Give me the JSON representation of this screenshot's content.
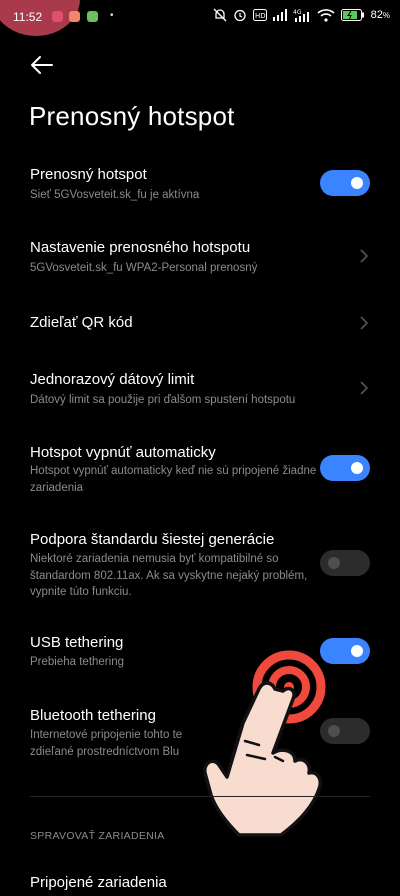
{
  "status_bar": {
    "time": "11:52",
    "battery_pct": "82",
    "extra_dot": "•",
    "network_label": "4G",
    "colors": {
      "recording": "#a93a4c",
      "notif1": "#e0506e",
      "notif2": "#f0876b",
      "notif3": "#6ac259"
    }
  },
  "header": {
    "back_icon": "arrow-left-icon",
    "title": "Prenosný hotspot"
  },
  "settings": {
    "portable_hotspot": {
      "title": "Prenosný hotspot",
      "subtitle": "Sieť 5GVosveteit.sk_fu je aktívna",
      "toggle_on": true
    },
    "hotspot_config": {
      "title": "Nastavenie prenosného hotspotu",
      "subtitle": "5GVosveteit.sk_fu WPA2-Personal prenosný"
    },
    "share_qr": {
      "title": "Zdieľať QR kód"
    },
    "data_limit": {
      "title": "Jednorazový dátový limit",
      "subtitle": "Dátový limit sa použije pri ďalšom spustení hotspotu"
    },
    "auto_off": {
      "title": "Hotspot vypnúť automaticky",
      "subtitle": "Hotspot vypnúť automaticky keď nie sú pripojené žiadne zariadenia",
      "toggle_on": true
    },
    "wifi6": {
      "title": "Podpora štandardu šiestej generácie",
      "subtitle": "Niektoré zariadenia nemusia byť kompatibilné so štandardom 802.11ax. Ak sa vyskytne nejaký problém, vypnite túto funkciu.",
      "toggle_on": false
    },
    "usb_tethering": {
      "title": "USB tethering",
      "subtitle": "Prebieha tethering",
      "toggle_on": true
    },
    "bt_tethering": {
      "title": "Bluetooth tethering",
      "subtitle": "Internetové pripojenie tohto te zdieľané prostredníctvom Blu",
      "toggle_on": false
    }
  },
  "manage_devices": {
    "section_title": "SPRAVOVAŤ ZARIADENIA",
    "connected_devices": "Pripojené zariadenia"
  },
  "colors": {
    "accent": "#3a84ff",
    "background": "#000000",
    "secondary_text": "#8b8b8b"
  }
}
